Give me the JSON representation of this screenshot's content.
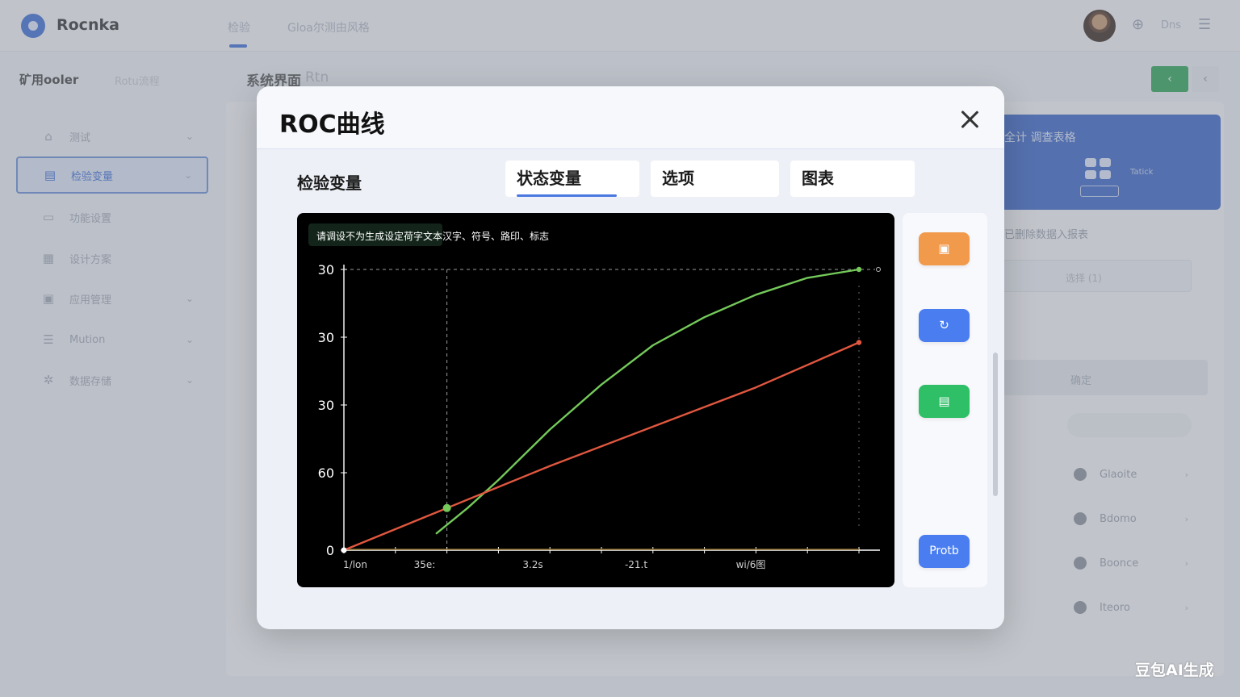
{
  "app": {
    "title": "Rocnka",
    "top_tabs": [
      "检验",
      "Gloa尔测由风格"
    ],
    "user": "Dns",
    "sub_heading": "矿用ooler",
    "sub_heading_secondary": "Rotu流程",
    "page_heading": "系统界面",
    "page_heading_secondary": "Rtn"
  },
  "sidebar": {
    "items": [
      {
        "label": "测试",
        "icon": "home-icon",
        "active": false
      },
      {
        "label": "检验变量",
        "icon": "document-icon",
        "active": true
      },
      {
        "label": "功能设置",
        "icon": "monitor-icon",
        "active": false
      },
      {
        "label": "设计方案",
        "icon": "chart-icon",
        "active": false
      },
      {
        "label": "应用管理",
        "icon": "grid-icon",
        "active": false
      },
      {
        "label": "Mution",
        "icon": "list-icon",
        "active": false
      },
      {
        "label": "数据存储",
        "icon": "settings-icon",
        "active": false
      }
    ]
  },
  "right_panel": {
    "card_title": "全计 调查表格",
    "card_sub": "Tatick",
    "note": "已删除数据入报表",
    "field_text": "选择 (1)",
    "button_text": "确定",
    "rows": [
      "Glaoite",
      "Bdomo",
      "Boonce",
      "Iteoro"
    ]
  },
  "modal": {
    "title": "ROC曲线",
    "field_label": "检验变量",
    "tabs": [
      "状态变量",
      "选项",
      "图表"
    ],
    "active_tab": 0,
    "actions": [
      {
        "name": "export-action",
        "icon": "image-icon",
        "color": "#f19a4c"
      },
      {
        "name": "refresh-action",
        "icon": "refresh-icon",
        "color": "#4a7ef0"
      },
      {
        "name": "save-action",
        "icon": "save-icon",
        "color": "#2ebf67"
      }
    ],
    "primary_action": "Protb"
  },
  "chart_data": {
    "type": "line",
    "annotation": "请调设不为生成设定荷字文本汉字、符号、路印、标志",
    "y_tick_labels": [
      "30",
      "30",
      "30",
      "60",
      "0"
    ],
    "x_tick_labels": [
      "1/lon",
      "35e:",
      "3.2s",
      "-21.t",
      "wi/6图"
    ],
    "grid": true,
    "series": [
      {
        "color": "#74c95a",
        "x": [
          0.18,
          0.24,
          0.3,
          0.4,
          0.5,
          0.6,
          0.7,
          0.8,
          0.9,
          1.0
        ],
        "y": [
          0.06,
          0.15,
          0.25,
          0.43,
          0.59,
          0.73,
          0.83,
          0.91,
          0.97,
          1.0
        ]
      },
      {
        "color": "#e0573f",
        "x": [
          0.0,
          0.2,
          0.4,
          0.6,
          0.8,
          1.0
        ],
        "y": [
          0.0,
          0.15,
          0.3,
          0.44,
          0.58,
          0.74
        ]
      }
    ],
    "intersection": {
      "x": 0.2,
      "y": 0.15
    }
  },
  "watermark": "豆包AI生成"
}
